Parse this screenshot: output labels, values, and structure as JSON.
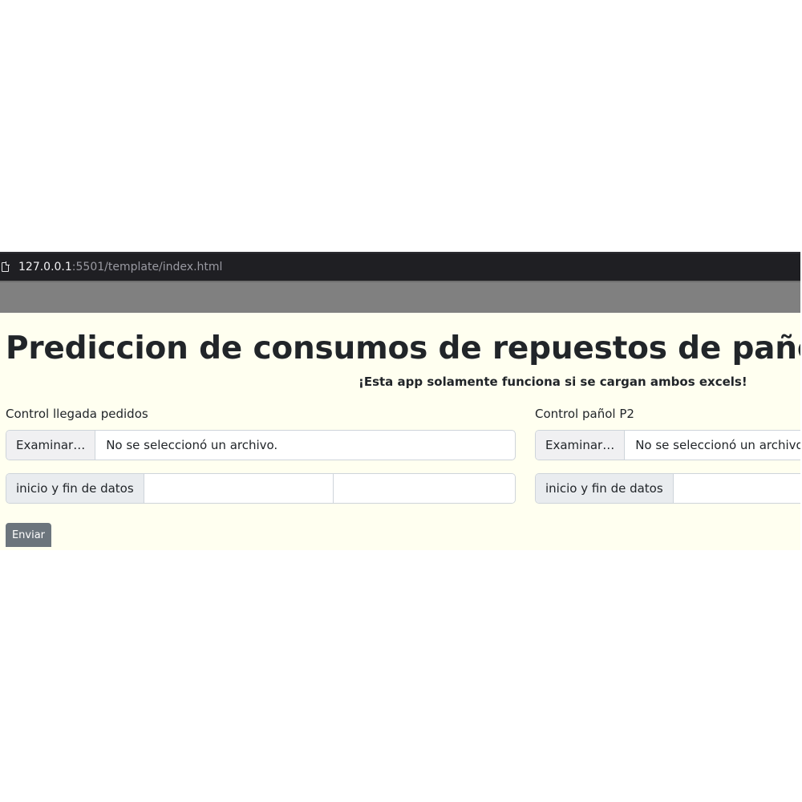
{
  "browser": {
    "url_host": "127.0.0.1",
    "url_rest": ":5501/template/index.html"
  },
  "page": {
    "title": "Prediccion de consumos de repuestos de pañol",
    "subtitle": "¡Esta app solamente funciona si se cargan ambos excels!",
    "background": "#fffff0"
  },
  "left_form": {
    "label": "Control llegada pedidos",
    "file_button": "Examinar…",
    "file_status": "No se seleccionó un archivo.",
    "range_label": "inicio y fin de datos",
    "start_value": "",
    "end_value": ""
  },
  "right_form": {
    "label": "Control pañol P2",
    "file_button": "Examinar…",
    "file_status": "No se seleccionó un archivo.",
    "range_label": "inicio y fin de datos",
    "start_value": ""
  },
  "submit": {
    "label": "Enviar",
    "color": "#6c757d"
  },
  "icons": {
    "url_icon": "document-icon"
  }
}
